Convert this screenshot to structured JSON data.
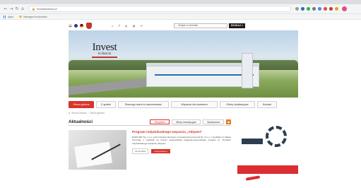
{
  "browser": {
    "url": "investwbarcin.pl",
    "bookmarks": [
      "Apps",
      "Managed bookmarks"
    ]
  },
  "site": {
    "search_placeholder": "Znajdź w serwisie",
    "search_button": "SZUKAJ »",
    "logo_title": "Invest",
    "logo_subtitle": "in Barcin",
    "nav": [
      "Strona główna",
      "O gminie",
      "Dlaczego warto tu zainwestować",
      "Wsparcie dla inwestora",
      "Oferty lokalizacyjne",
      "Kontakt"
    ],
    "breadcrumb": [
      "Strona Główna",
      "Strona główna"
    ],
    "news": {
      "title": "Aktualności",
      "tabs": [
        "Wszystkie",
        "Oferty inwestycyjne",
        "Wydarzenia"
      ],
      "article": {
        "title": "Program indywidualnego wsparcia „Aktywni”",
        "text": "EURO-BIT Sp. z o.o. wraz Instytutu Rozwoju i Innowacji Euro-Konsult Sp. Z o.o. z siedzibą w Lublinie informuje o realizacji na terenie województwa kujawsko-pomorskiego projektu pt. „Program indywidualnego wsparcia „Aktywni”",
        "date": "22.02.2019",
        "more": "czytaj więcej »"
      }
    }
  },
  "colors": {
    "accent": "#d9332b",
    "dark": "#1d1d1d"
  }
}
